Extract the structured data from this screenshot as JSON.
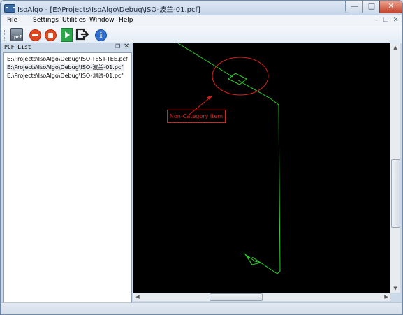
{
  "window": {
    "title": "IsoAlgo - [E:\\Projects\\IsoAlgo\\Debug\\ISO-波兰-01.pcf]",
    "min_glyph": "—",
    "max_glyph": "□",
    "close_glyph": "✕"
  },
  "menubar": {
    "items": [
      "File",
      "Settings",
      "Utilities",
      "Window",
      "Help"
    ],
    "mdi_minimize": "–",
    "mdi_restore": "❐",
    "mdi_close": "✕"
  },
  "toolbar": {
    "buttons": [
      {
        "name": "open-pcf",
        "icon": "pcf-file-icon",
        "label": "pcf"
      },
      {
        "name": "stop",
        "icon": "stop-icon"
      },
      {
        "name": "delete",
        "icon": "delete-icon"
      },
      {
        "name": "run",
        "icon": "play-icon"
      },
      {
        "name": "exit",
        "icon": "exit-icon"
      },
      {
        "name": "about",
        "icon": "info-icon",
        "label": "i"
      }
    ]
  },
  "panel": {
    "title": "PCF List",
    "float_glyph": "❐",
    "close_glyph": "✕",
    "files": [
      "E:\\Projects\\IsoAlgo\\Debug\\ISO-TEST-TEE.pcf",
      "E:\\Projects\\IsoAlgo\\Debug\\ISO-波兰-01.pcf",
      "E:\\Projects\\IsoAlgo\\Debug\\ISO-测试-01.pcf"
    ],
    "selected_index": 1
  },
  "viewport": {
    "annotation": "Non-Category Item",
    "colors": {
      "background": "#000000",
      "pipe": "#2bd12b",
      "annotation": "#d8231f"
    }
  },
  "scrollbars": {
    "up": "▲",
    "down": "▼",
    "left": "◀",
    "right": "▶"
  }
}
